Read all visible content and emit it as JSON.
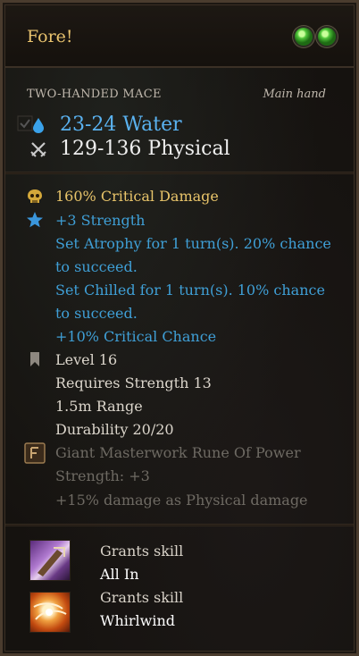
{
  "item": {
    "name": "Fore!",
    "rune_slots": 2,
    "type": "TWO-HANDED MACE",
    "hand": "Main hand",
    "damage": [
      {
        "text": "23-24 Water",
        "icon": "water-drop-icon",
        "color": "#5ab2f0"
      },
      {
        "text": "129-136 Physical",
        "icon": "crossed-swords-icon",
        "color": "#efefef"
      }
    ]
  },
  "stats": {
    "crit_damage": "160%  Critical Damage",
    "strength": "+3  Strength",
    "atrophy_1": "Set Atrophy for 1 turn(s). 20% chance",
    "atrophy_2": "to succeed.",
    "chilled_1": "Set Chilled for 1 turn(s). 10% chance",
    "chilled_2": "to succeed.",
    "crit_chance": "+10%  Critical Chance",
    "level": "Level  16",
    "requires": "Requires Strength 13",
    "range": "1.5m  Range",
    "durability": "Durability  20/20"
  },
  "rune": {
    "name": "Giant Masterwork Rune Of Power",
    "strength": "Strength: +3",
    "bonus": "+15% damage as Physical damage"
  },
  "skills": [
    {
      "label": "Grants skill",
      "name": "All In"
    },
    {
      "label": "Grants skill",
      "name": "Whirlwind"
    }
  ],
  "colors": {
    "title": "#e9c36e",
    "gold_stat": "#e8c46a",
    "blue_stat": "#3f9fd6",
    "inactive_rune": "#6e6a63"
  }
}
